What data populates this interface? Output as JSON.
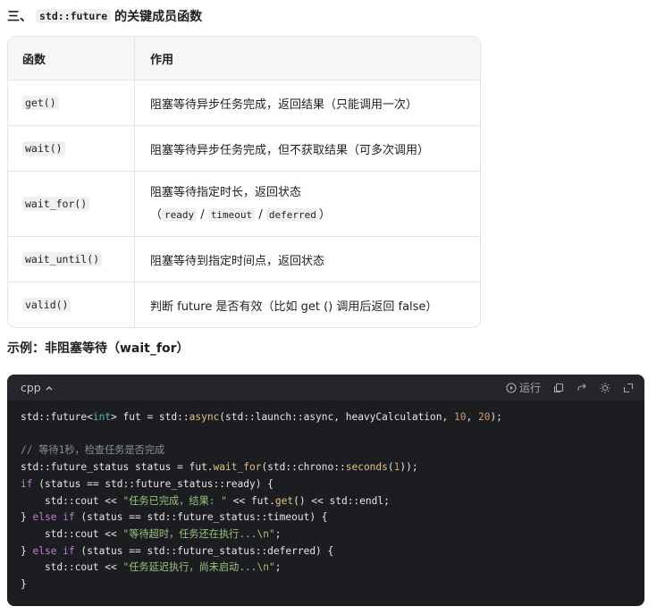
{
  "section": {
    "prefix": "三、",
    "code": "std::future",
    "suffix": "的关键成员函数"
  },
  "table": {
    "headers": [
      "函数",
      "作用"
    ],
    "rows": [
      {
        "fn": "get()",
        "desc": "阻塞等待异步任务完成，返回结果（只能调用一次）"
      },
      {
        "fn": "wait()",
        "desc": "阻塞等待异步任务完成，但不获取结果（可多次调用）"
      },
      {
        "fn": "wait_for()",
        "desc": "阻塞等待指定时长，返回状态",
        "paren_open": "（",
        "s1": "ready",
        "sep1": "/",
        "s2": "timeout",
        "sep2": "/",
        "s3": "deferred",
        "paren_close": "）"
      },
      {
        "fn": "wait_until()",
        "desc": "阻塞等待到指定时间点，返回状态"
      },
      {
        "fn": "valid()",
        "desc": "判断 future 是否有效（比如 get () 调用后返回 false）"
      }
    ]
  },
  "example_title": "示例：非阻塞等待（wait_for）",
  "code_block": {
    "language": "cpp",
    "run_label": "运行",
    "lines": [
      "std::future<int> fut = std::async(std::launch::async, heavyCalculation, 10, 20);",
      "",
      "// 等待1秒，检查任务是否完成",
      "std::future_status status = fut.wait_for(std::chrono::seconds(1));",
      "if (status == std::future_status::ready) {",
      "    std::cout << \"任务已完成，结果: \" << fut.get() << std::endl;",
      "} else if (status == std::future_status::timeout) {",
      "    std::cout << \"等待超时，任务还在执行...\\n\";",
      "} else if (status == std::future_status::deferred) {",
      "    std::cout << \"任务延迟执行，尚未启动...\\n\";",
      "}"
    ]
  }
}
